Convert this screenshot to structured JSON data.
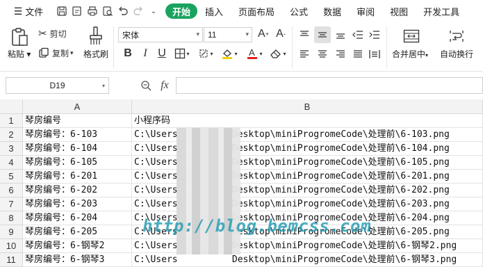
{
  "menubar": {
    "file_label": "文件",
    "tabs": [
      "开始",
      "插入",
      "页面布局",
      "公式",
      "数据",
      "审阅",
      "视图",
      "开发工具"
    ],
    "active_tab": "开始"
  },
  "ribbon": {
    "paste": "粘贴",
    "cut": "剪切",
    "copy": "复制",
    "format_painter": "格式刷",
    "font_name": "宋体",
    "font_size": "11",
    "merge_center": "合并居中",
    "wrap_text": "自动换行"
  },
  "formula_bar": {
    "name_box": "D19",
    "fx": "fx",
    "formula": ""
  },
  "sheet": {
    "columns": [
      "A",
      "B"
    ],
    "rows": [
      {
        "n": "1",
        "a": "琴房编号",
        "b": "小程序码"
      },
      {
        "n": "2",
        "a": "琴房编号：6-103",
        "b": "C:\\Users          Desktop\\miniProgromeCode\\处理前\\6-103.png"
      },
      {
        "n": "3",
        "a": "琴房编号：6-104",
        "b": "C:\\Users          Desktop\\miniProgromeCode\\处理前\\6-104.png"
      },
      {
        "n": "4",
        "a": "琴房编号：6-105",
        "b": "C:\\Users          Desktop\\miniProgromeCode\\处理前\\6-105.png"
      },
      {
        "n": "5",
        "a": "琴房编号：6-201",
        "b": "C:\\Users          Desktop\\miniProgromeCode\\处理前\\6-201.png"
      },
      {
        "n": "6",
        "a": "琴房编号：6-202",
        "b": "C:\\Users          Desktop\\miniProgromeCode\\处理前\\6-202.png"
      },
      {
        "n": "7",
        "a": "琴房编号：6-203",
        "b": "C:\\Users          Desktop\\miniProgromeCode\\处理前\\6-203.png"
      },
      {
        "n": "8",
        "a": "琴房编号：6-204",
        "b": "C:\\Users          Desktop\\miniProgromeCode\\处理前\\6-204.png"
      },
      {
        "n": "9",
        "a": "琴房编号：6-205",
        "b": "C:\\Users          Desktop\\miniProgromeCode\\处理前\\6-205.png"
      },
      {
        "n": "10",
        "a": "琴房编号：6-钢琴2",
        "b": "C:\\Users          Desktop\\miniProgromeCode\\处理前\\6-钢琴2.png"
      },
      {
        "n": "11",
        "a": "琴房编号：6-钢琴3",
        "b": "C:\\Users          Desktop\\miniProgromeCode\\处理前\\6-钢琴3.png"
      }
    ]
  },
  "watermark": "http://blog.bemcss.com",
  "colors": {
    "accent": "#1aa35f",
    "watermark": "#2a9fb5"
  }
}
